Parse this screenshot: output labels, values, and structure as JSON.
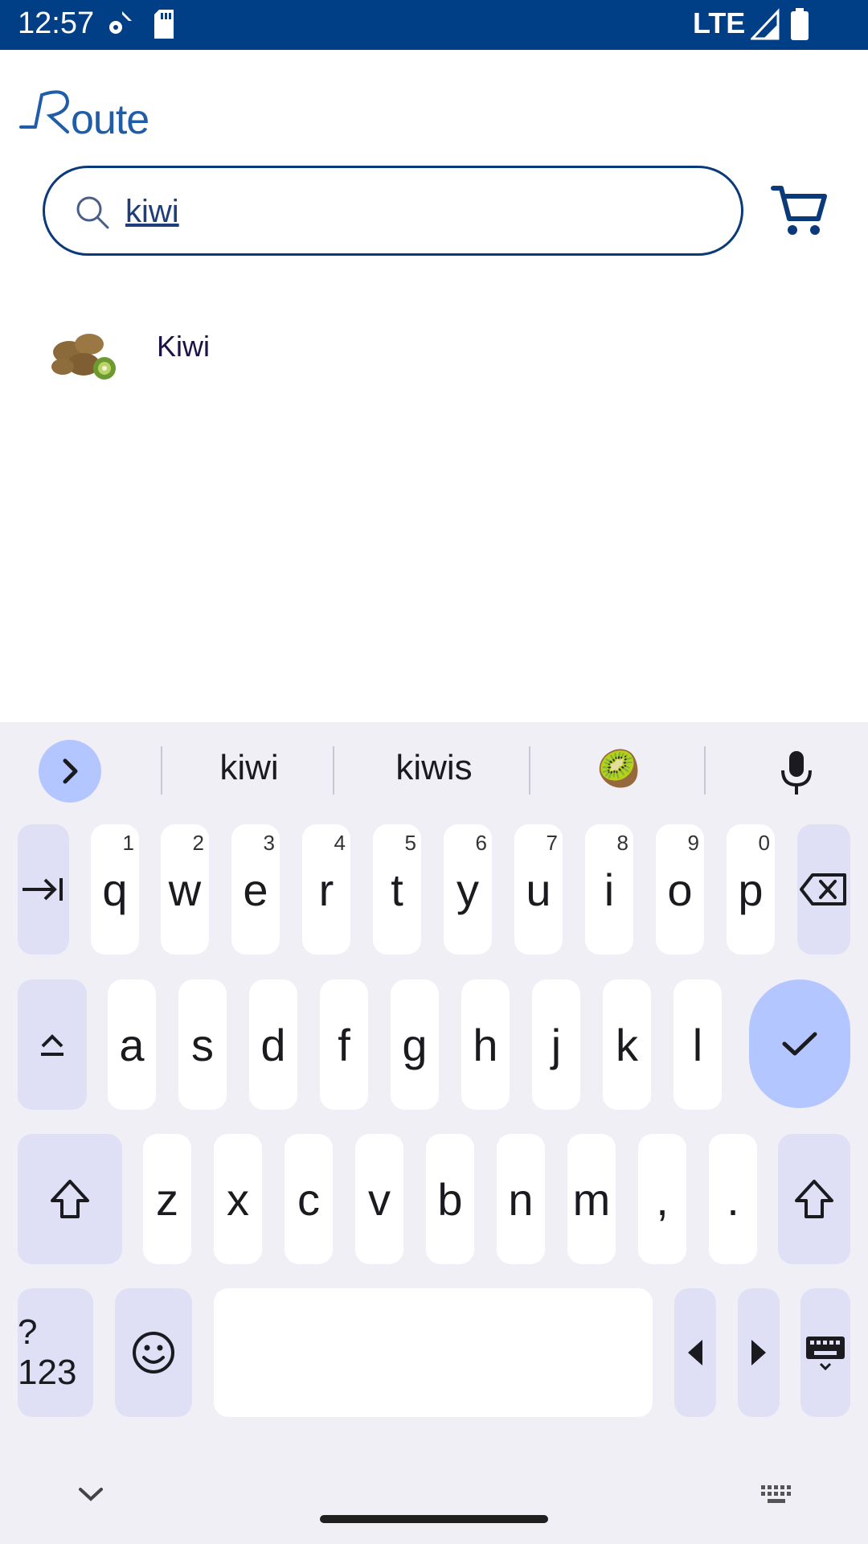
{
  "status_bar": {
    "time": "12:57",
    "network": "LTE"
  },
  "app": {
    "logo_text": "Route"
  },
  "search": {
    "value": "kiwi",
    "placeholder": ""
  },
  "results": [
    {
      "label": "Kiwi"
    }
  ],
  "keyboard": {
    "suggestions": [
      "kiwi",
      "kiwis",
      "🥝"
    ],
    "row1": [
      {
        "k": "q",
        "n": "1"
      },
      {
        "k": "w",
        "n": "2"
      },
      {
        "k": "e",
        "n": "3"
      },
      {
        "k": "r",
        "n": "4"
      },
      {
        "k": "t",
        "n": "5"
      },
      {
        "k": "y",
        "n": "6"
      },
      {
        "k": "u",
        "n": "7"
      },
      {
        "k": "i",
        "n": "8"
      },
      {
        "k": "o",
        "n": "9"
      },
      {
        "k": "p",
        "n": "0"
      }
    ],
    "row2": [
      "a",
      "s",
      "d",
      "f",
      "g",
      "h",
      "j",
      "k",
      "l"
    ],
    "row3": [
      "z",
      "x",
      "c",
      "v",
      "b",
      "n",
      "m",
      ",",
      "."
    ],
    "symbols_label": "?123"
  }
}
